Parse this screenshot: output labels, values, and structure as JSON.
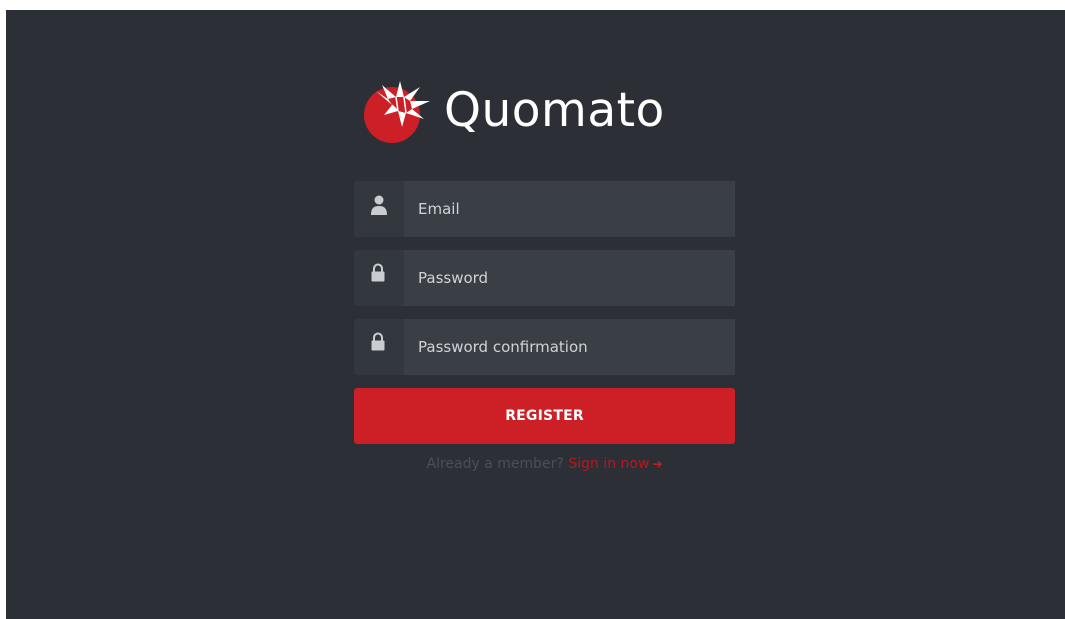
{
  "brand": {
    "name": "Quomato",
    "logo_icon": "tomato-logo-icon",
    "accent_color": "#cc1f26"
  },
  "form": {
    "email": {
      "placeholder": "Email",
      "icon": "user-icon"
    },
    "password": {
      "placeholder": "Password",
      "icon": "lock-icon"
    },
    "password_confirmation": {
      "placeholder": "Password confirmation",
      "icon": "lock-icon"
    },
    "register_label": "REGISTER"
  },
  "footer": {
    "prompt": "Already a member?",
    "signin_label": "Sign in now",
    "signin_icon": "arrow-right-icon"
  },
  "colors": {
    "background": "#2c3036",
    "input_background": "#3a3f46",
    "addon_background": "#33383e",
    "button": "#cc1f26"
  }
}
